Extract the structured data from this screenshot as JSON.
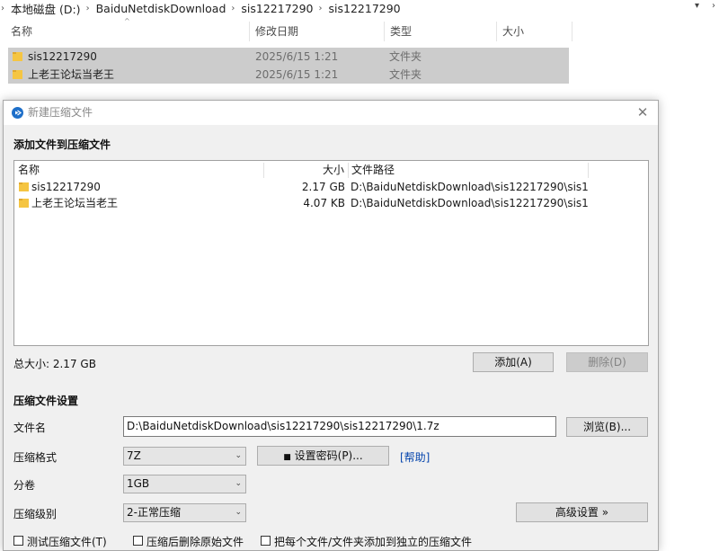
{
  "explorer": {
    "breadcrumb": [
      "本地磁盘 (D:)",
      "BaiduNetdiskDownload",
      "sis12217290",
      "sis12217290"
    ],
    "columns": {
      "name": "名称",
      "date": "修改日期",
      "type": "类型",
      "size": "大小"
    },
    "files": [
      {
        "name": "sis12217290",
        "date": "2025/6/15 1:21",
        "type": "文件夹"
      },
      {
        "name": "上老王论坛当老王",
        "date": "2025/6/15 1:21",
        "type": "文件夹"
      }
    ]
  },
  "dialog": {
    "title": "新建压缩文件",
    "add_section_title": "添加文件到压缩文件",
    "list_headers": {
      "name": "名称",
      "size": "大小",
      "path": "文件路径"
    },
    "list_items": [
      {
        "name": "sis12217290",
        "size": "2.17 GB",
        "path": "D:\\BaiduNetdiskDownload\\sis12217290\\sis1..."
      },
      {
        "name": "上老王论坛当老王",
        "size": "4.07 KB",
        "path": "D:\\BaiduNetdiskDownload\\sis12217290\\sis1..."
      }
    ],
    "total_size": "总大小: 2.17 GB",
    "add_button": "添加(A)",
    "delete_button": "删除(D)",
    "settings_title": "压缩文件设置",
    "filename_label": "文件名",
    "filename_value": "D:\\BaiduNetdiskDownload\\sis12217290\\sis12217290\\1.7z",
    "browse_button": "浏览(B)...",
    "format_label": "压缩格式",
    "format_value": "7Z",
    "password_button": "设置密码(P)...",
    "help_link": "[帮助]",
    "volume_label": "分卷",
    "volume_value": "1GB",
    "level_label": "压缩级别",
    "level_value": "2-正常压缩",
    "advanced_button": "高级设置 »",
    "checkboxes": [
      {
        "label": "测试压缩文件(T)",
        "checked": false
      },
      {
        "label": "压缩后删除原始文件",
        "checked": false
      },
      {
        "label": "把每个文件/文件夹添加到独立的压缩文件",
        "checked": false
      }
    ]
  },
  "colors": {
    "folder": "#f5c542",
    "selection": "#cccccc",
    "dialog_bg": "#f0f0f0",
    "link": "#0645ad",
    "app_icon": "#1e6fc9"
  }
}
